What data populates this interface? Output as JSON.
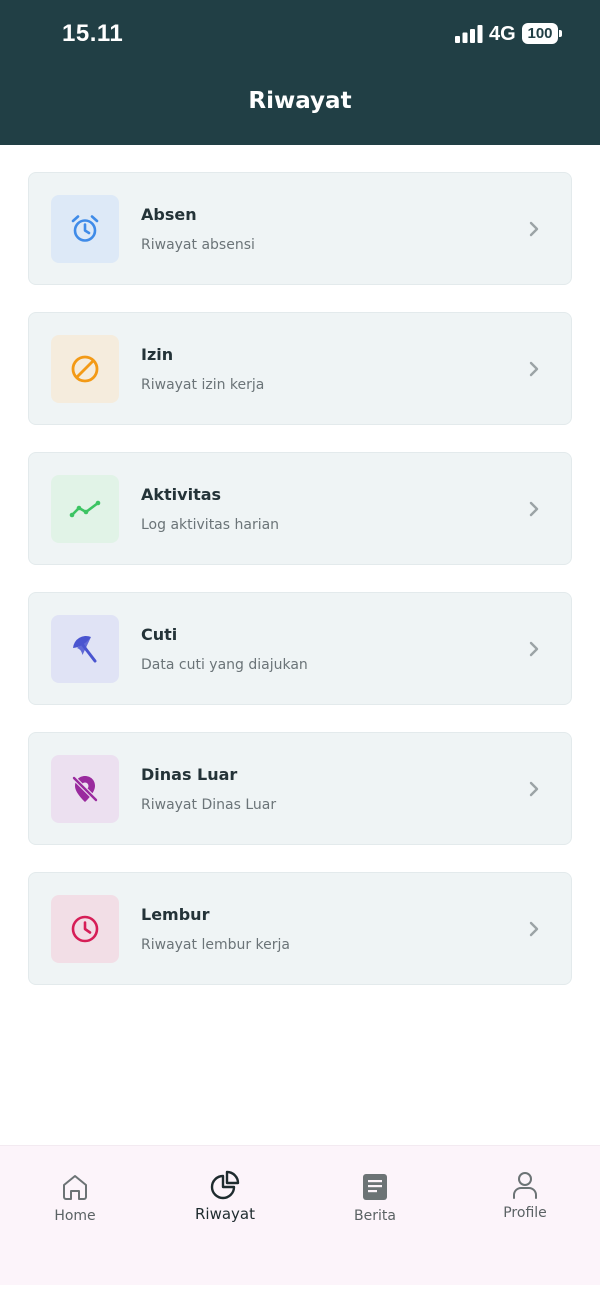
{
  "status_bar": {
    "time": "15.11",
    "network": "4G",
    "battery": "100"
  },
  "header": {
    "title": "Riwayat"
  },
  "items": [
    {
      "title": "Absen",
      "subtitle": "Riwayat absensi",
      "icon": "alarm-clock-icon",
      "color": "#3f8be8",
      "bg": "#dde9f7"
    },
    {
      "title": "Izin",
      "subtitle": "Riwayat izin kerja",
      "icon": "block-icon",
      "color": "#f39a16",
      "bg": "#f5ecdd"
    },
    {
      "title": "Aktivitas",
      "subtitle": "Log aktivitas harian",
      "icon": "trend-line-icon",
      "color": "#3cc463",
      "bg": "#e1f3e7"
    },
    {
      "title": "Cuti",
      "subtitle": "Data cuti yang diajukan",
      "icon": "beach-umbrella-icon",
      "color": "#4a55d0",
      "bg": "#e0e3f5"
    },
    {
      "title": "Dinas Luar",
      "subtitle": "Riwayat Dinas Luar",
      "icon": "location-off-icon",
      "color": "#9a2a9e",
      "bg": "#ece0f0"
    },
    {
      "title": "Lembur",
      "subtitle": "Riwayat lembur kerja",
      "icon": "clock-icon",
      "color": "#d61e57",
      "bg": "#f2dee6"
    }
  ],
  "bottom_nav": [
    {
      "label": "Home",
      "icon": "home-icon",
      "active": false
    },
    {
      "label": "Riwayat",
      "icon": "pie-chart-icon",
      "active": true
    },
    {
      "label": "Berita",
      "icon": "news-icon",
      "active": false
    },
    {
      "label": "Profile",
      "icon": "person-icon",
      "active": false
    }
  ]
}
